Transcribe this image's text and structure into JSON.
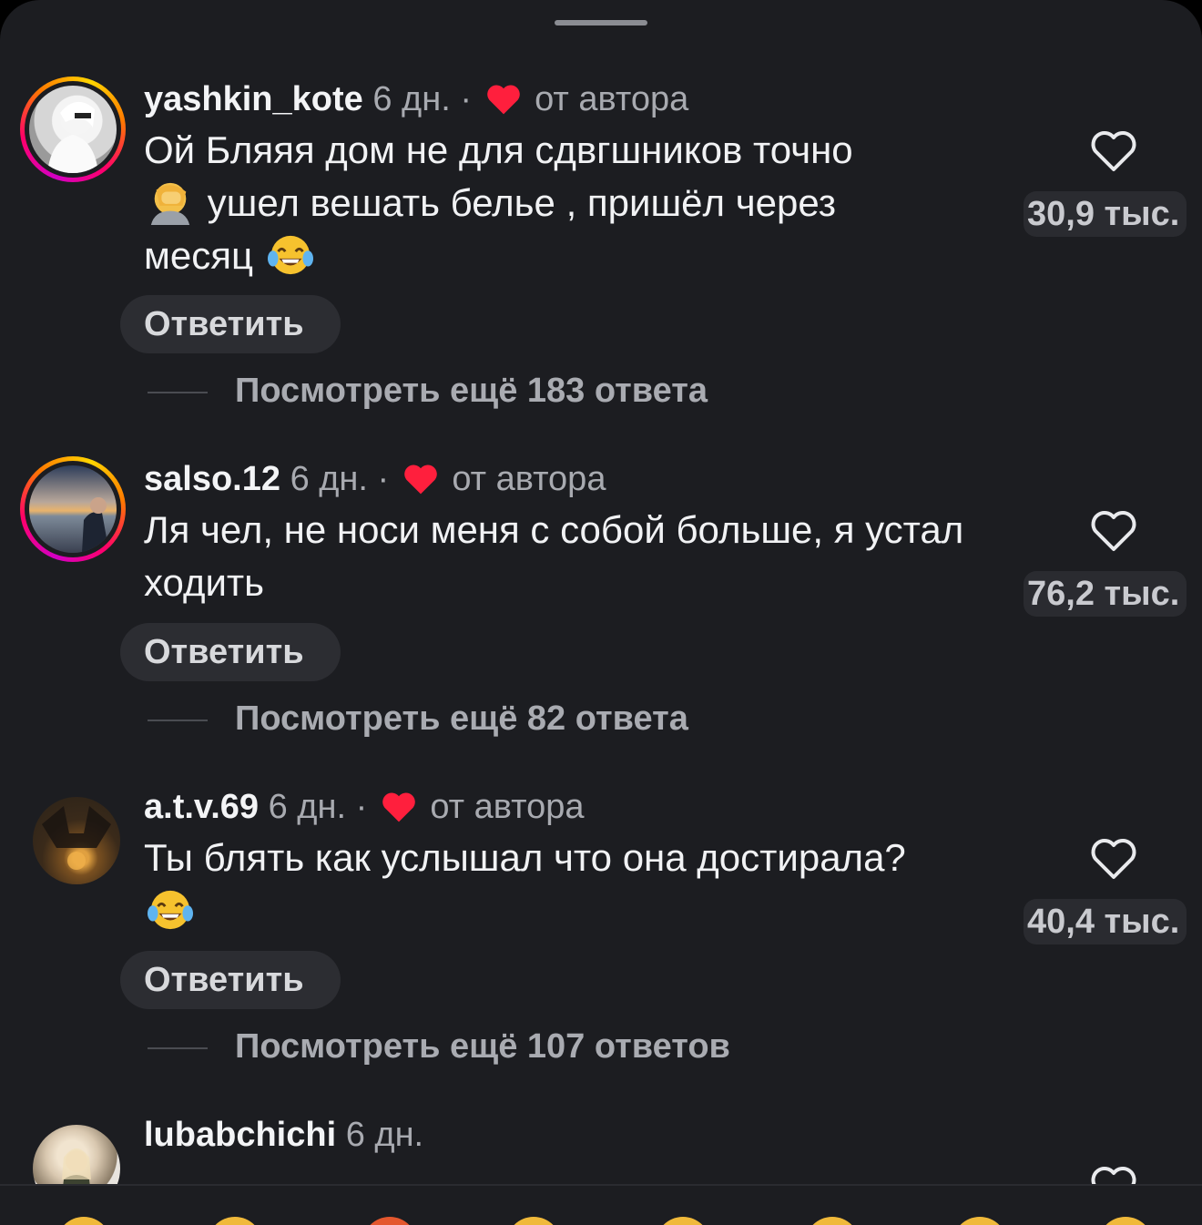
{
  "comments": [
    {
      "username": "yashkin_kote",
      "time": "6 дн.",
      "author_label": "от автора",
      "text_parts": [
        "Ой Бляяя дом не для сдвгшников точно",
        "ушел вешать белье , пришёл через",
        "месяц"
      ],
      "emoji": [
        "face-palm-emoji",
        "tears-of-joy-emoji"
      ],
      "likes": "30,9 тыс.",
      "reply_label": "Ответить",
      "more_replies": "Посмотреть ещё 183 ответа"
    },
    {
      "username": "salso.12",
      "time": "6 дн.",
      "author_label": "от автора",
      "text": "Ля чел, не носи меня с собой больше, я устал ходить",
      "likes": "76,2 тыс.",
      "reply_label": "Ответить",
      "more_replies": "Посмотреть ещё 82 ответа"
    },
    {
      "username": "a.t.v.69",
      "time": "6 дн.",
      "author_label": "от автора",
      "text": "Ты блять как услышал что она достирала?",
      "emoji": [
        "tears-of-joy-emoji"
      ],
      "likes": "40,4 тыс.",
      "reply_label": "Ответить",
      "more_replies": "Посмотреть ещё 107 ответов"
    },
    {
      "username": "lubabchichi",
      "time": "6 дн."
    }
  ],
  "colors": {
    "background": "#1c1d21",
    "heart_red": "#ff1f3d",
    "text_primary": "#f1f2f4",
    "text_secondary": "#a8aab0"
  }
}
